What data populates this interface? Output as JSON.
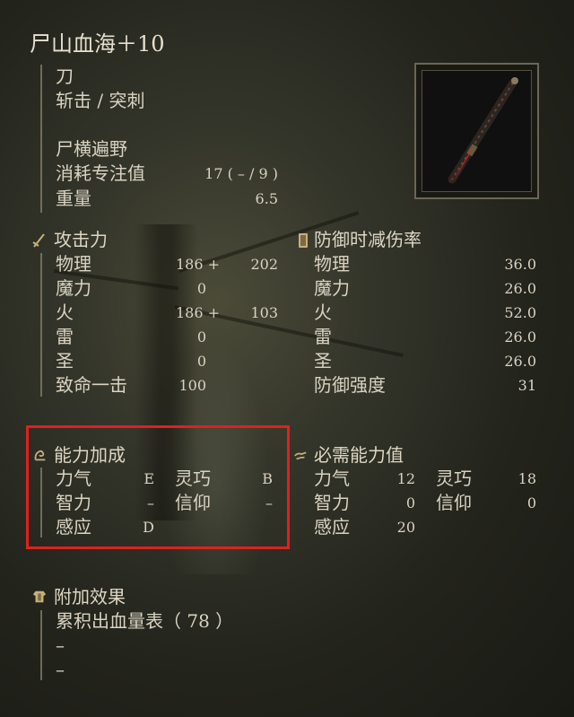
{
  "weapon": {
    "name": "尸山血海＋10",
    "type": "刀",
    "attack_type": "斩击 / 突刺",
    "skill": "尸横遍野",
    "fp_label": "消耗专注值",
    "fp_value": "17 (  – /   9 )",
    "weight_label": "重量",
    "weight_value": "6.5"
  },
  "attack": {
    "header": "攻击力",
    "rows": [
      {
        "label": "物理",
        "base": "186 +",
        "bonus": "202"
      },
      {
        "label": "魔力",
        "base": "0",
        "bonus": ""
      },
      {
        "label": "火",
        "base": "186 +",
        "bonus": "103"
      },
      {
        "label": "雷",
        "base": "0",
        "bonus": ""
      },
      {
        "label": "圣",
        "base": "0",
        "bonus": ""
      },
      {
        "label": "致命一击",
        "base": "100",
        "bonus": ""
      }
    ]
  },
  "defense": {
    "header": "防御时减伤率",
    "rows": [
      {
        "label": "物理",
        "value": "36.0"
      },
      {
        "label": "魔力",
        "value": "26.0"
      },
      {
        "label": "火",
        "value": "52.0"
      },
      {
        "label": "雷",
        "value": "26.0"
      },
      {
        "label": "圣",
        "value": "26.0"
      },
      {
        "label": "防御强度",
        "value": "31"
      }
    ]
  },
  "scaling": {
    "header": "能力加成",
    "str_label": "力气",
    "str": "E",
    "dex_label": "灵巧",
    "dex": "B",
    "int_label": "智力",
    "int": "–",
    "fai_label": "信仰",
    "fai": "–",
    "arc_label": "感应",
    "arc": "D"
  },
  "requirements": {
    "header": "必需能力值",
    "str_label": "力气",
    "str": "12",
    "dex_label": "灵巧",
    "dex": "18",
    "int_label": "智力",
    "int": "0",
    "fai_label": "信仰",
    "fai": "0",
    "arc_label": "感应",
    "arc": "20"
  },
  "effects": {
    "header": "附加效果",
    "items": [
      "累积出血量表（ 78 ）",
      "–",
      "–"
    ]
  },
  "colors": {
    "highlight": "#e02020",
    "text": "#d9d3c2",
    "accent_icon": "#c8b07a"
  }
}
